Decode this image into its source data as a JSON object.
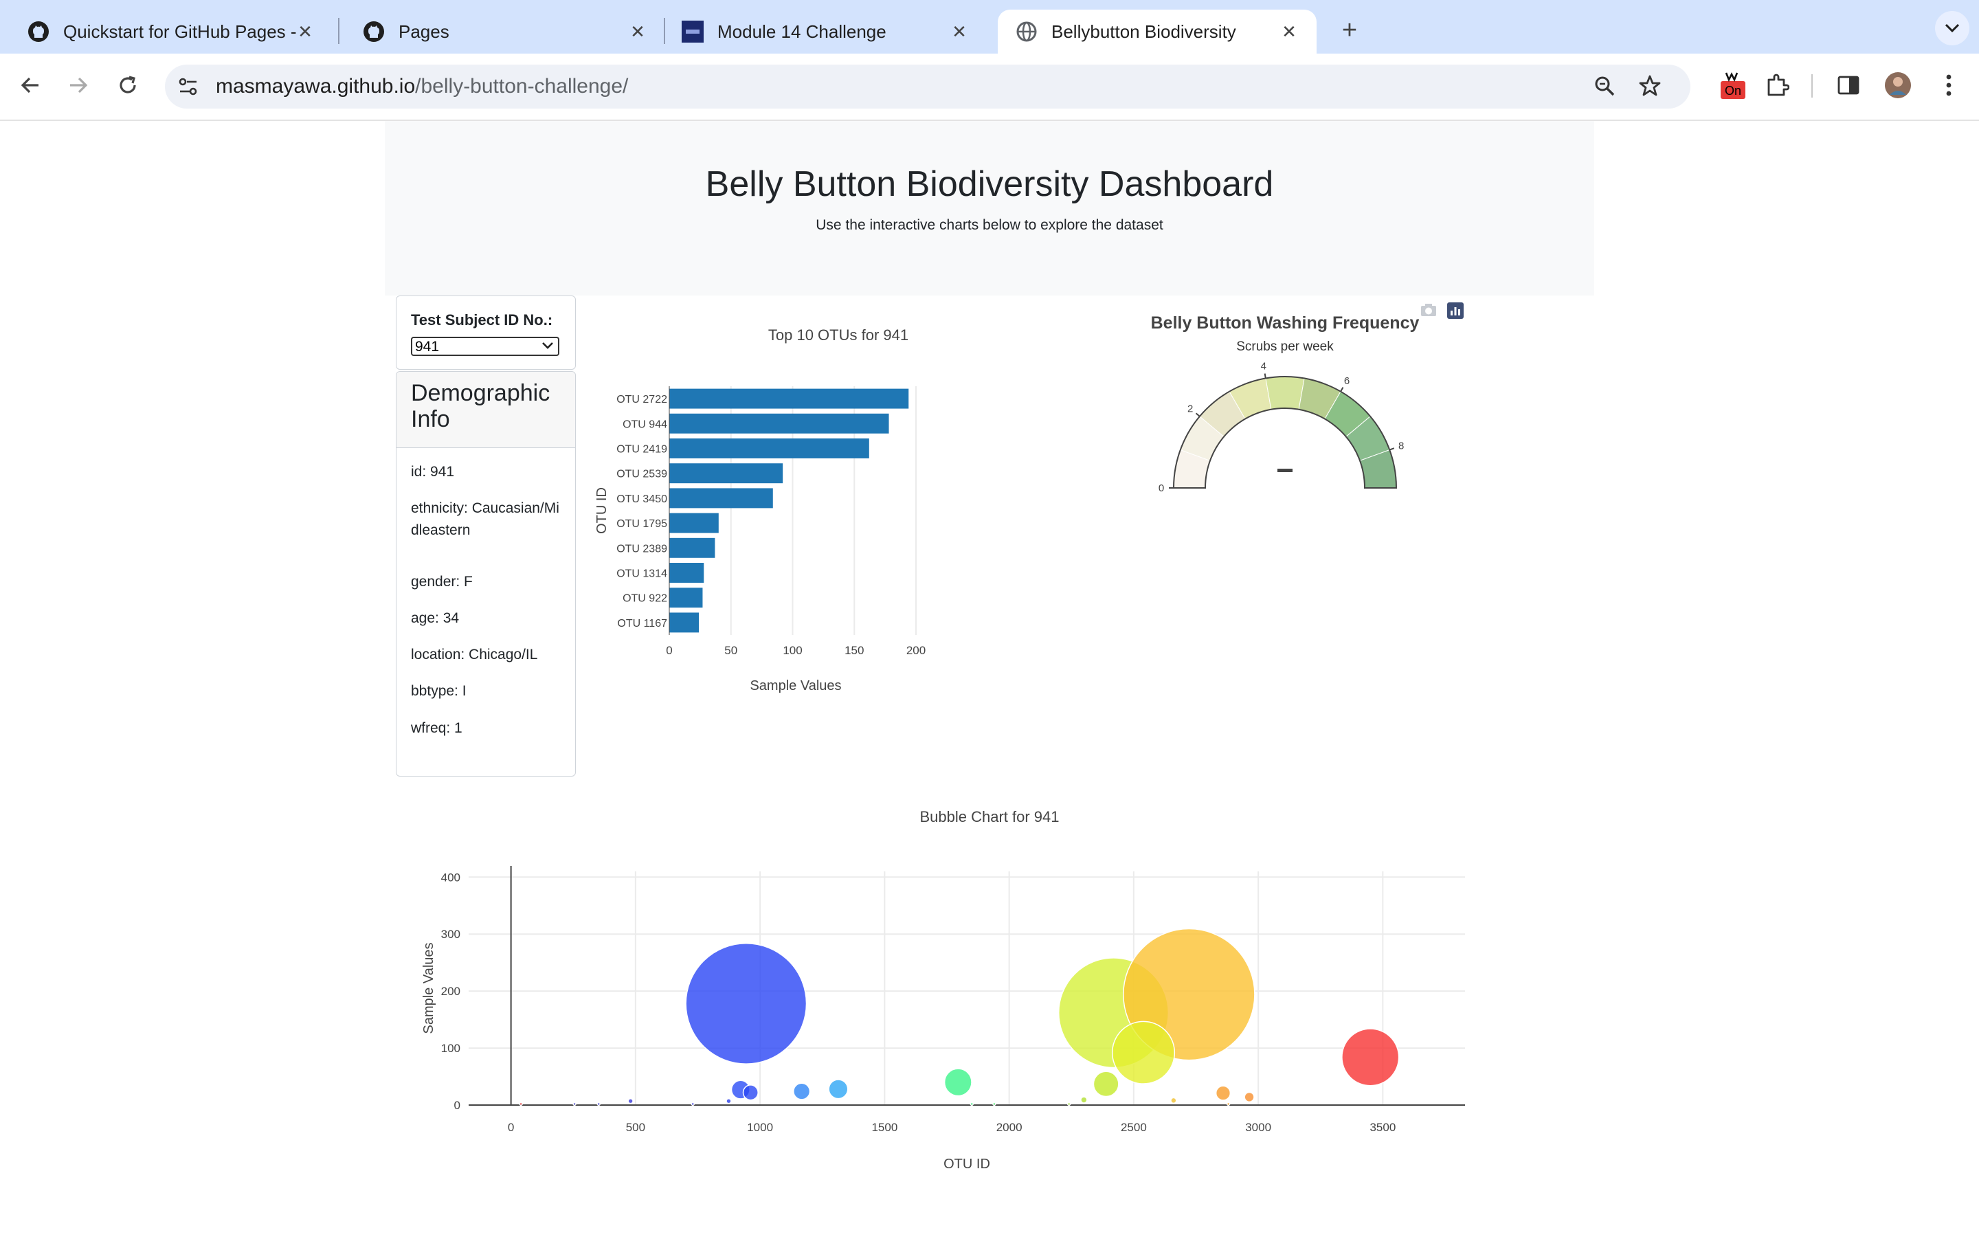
{
  "browser": {
    "tabs": [
      {
        "title": "Quickstart for GitHub Pages -",
        "icon": "github-icon"
      },
      {
        "title": "Pages",
        "icon": "github-icon"
      },
      {
        "title": "Module 14 Challenge",
        "icon": "course-logo-icon"
      },
      {
        "title": "Bellybutton Biodiversity",
        "icon": "globe-icon",
        "active": true
      }
    ],
    "url_host": "masmayawa.github.io",
    "url_path": "/belly-button-challenge/",
    "extension_badge": "On"
  },
  "page": {
    "title": "Belly Button Biodiversity Dashboard",
    "subtitle": "Use the interactive charts below to explore the dataset"
  },
  "selector": {
    "label": "Test Subject ID No.:",
    "value": "941"
  },
  "demographics": {
    "heading": "Demographic Info",
    "items": [
      "id: 941",
      "ethnicity: Caucasian/Midleastern",
      "gender: F",
      "age: 34",
      "location: Chicago/IL",
      "bbtype: I",
      "wfreq: 1"
    ]
  },
  "chart_data": [
    {
      "type": "bar",
      "orientation": "horizontal",
      "title": "Top 10 OTUs for 941",
      "xlabel": "Sample Values",
      "ylabel": "OTU ID",
      "categories": [
        "OTU 2722",
        "OTU 944",
        "OTU 2419",
        "OTU 2539",
        "OTU 3450",
        "OTU 1795",
        "OTU 2389",
        "OTU 1314",
        "OTU 922",
        "OTU 1167"
      ],
      "values": [
        194,
        178,
        162,
        92,
        84,
        40,
        37,
        28,
        27,
        24
      ],
      "xlim": [
        0,
        205
      ],
      "xticks": [
        0,
        50,
        100,
        150,
        200
      ],
      "color": "#1f77b4",
      "grid": true
    },
    {
      "type": "gauge",
      "title": "Belly Button Washing Frequency",
      "subtitle": "Scrubs per week",
      "range": [
        0,
        9
      ],
      "ticks": [
        0,
        2,
        4,
        6,
        8
      ],
      "value": 1,
      "step_colors": [
        "#f8f3ec",
        "#f4f1e4",
        "#e9e6ca",
        "#e5e8b0",
        "#d5e49d",
        "#b7cd8f",
        "#8bc086",
        "#89bc8d",
        "#84b589"
      ]
    },
    {
      "type": "scatter",
      "title": "Bubble Chart for 941",
      "xlabel": "OTU ID",
      "ylabel": "Sample Values",
      "xlim": [
        -170,
        3830
      ],
      "ylim": [
        0,
        410
      ],
      "xticks": [
        0,
        500,
        1000,
        1500,
        2000,
        2500,
        3000,
        3500
      ],
      "yticks": [
        0,
        100,
        200,
        300,
        400
      ],
      "grid": true,
      "points": [
        {
          "x": 944,
          "y": 178,
          "color": "#2a46f5"
        },
        {
          "x": 2419,
          "y": 162,
          "color": "#d6f03a"
        },
        {
          "x": 2722,
          "y": 194,
          "color": "#fbc232"
        },
        {
          "x": 2539,
          "y": 92,
          "color": "#e4ef2e"
        },
        {
          "x": 3450,
          "y": 84,
          "color": "#f73333"
        },
        {
          "x": 1795,
          "y": 40,
          "color": "#3cf489"
        },
        {
          "x": 2389,
          "y": 37,
          "color": "#c4ea2a"
        },
        {
          "x": 1314,
          "y": 28,
          "color": "#2ea6f5"
        },
        {
          "x": 922,
          "y": 27,
          "color": "#2c4ef6"
        },
        {
          "x": 1167,
          "y": 24,
          "color": "#2f86f5"
        },
        {
          "x": 962,
          "y": 22,
          "color": "#2b48f4"
        },
        {
          "x": 2859,
          "y": 21,
          "color": "#f79c2c"
        },
        {
          "x": 2964,
          "y": 14,
          "color": "#f79030"
        },
        {
          "x": 2300,
          "y": 9,
          "color": "#b0e030"
        },
        {
          "x": 2660,
          "y": 8,
          "color": "#f0c030"
        },
        {
          "x": 480,
          "y": 7,
          "color": "#3a3ad8"
        },
        {
          "x": 874,
          "y": 7,
          "color": "#2a3ee8"
        },
        {
          "x": 40,
          "y": 2,
          "color": "#e23a3a"
        },
        {
          "x": 255,
          "y": 2,
          "color": "#5050d0"
        },
        {
          "x": 352,
          "y": 2,
          "color": "#4848d4"
        },
        {
          "x": 730,
          "y": 2,
          "color": "#3a3ee0"
        },
        {
          "x": 1850,
          "y": 2,
          "color": "#40f080"
        },
        {
          "x": 1940,
          "y": 2,
          "color": "#50f070"
        },
        {
          "x": 2240,
          "y": 2,
          "color": "#a0e040"
        },
        {
          "x": 2880,
          "y": 2,
          "color": "#f0a030"
        }
      ]
    }
  ]
}
